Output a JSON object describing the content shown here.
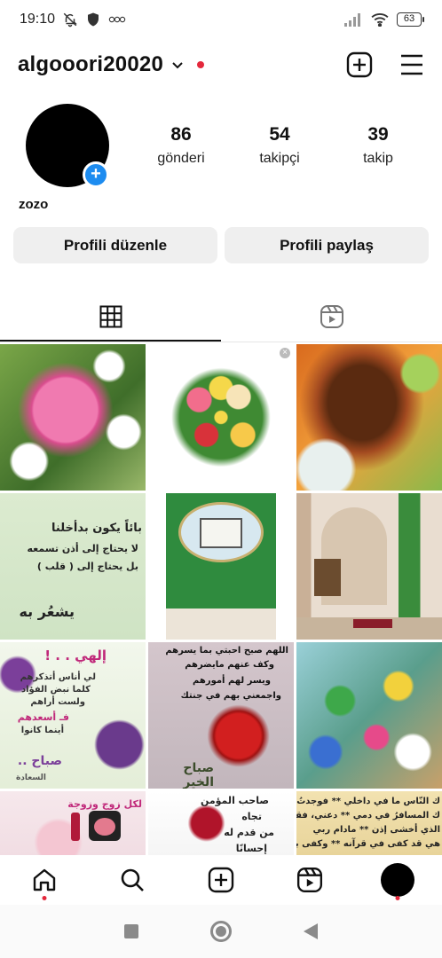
{
  "status_bar": {
    "time": "19:10",
    "battery": "63"
  },
  "header": {
    "username": "algooori20020"
  },
  "profile": {
    "display_name": "zozo",
    "stats": [
      {
        "value": "86",
        "label": "gönderi"
      },
      {
        "value": "54",
        "label": "takipçi"
      },
      {
        "value": "39",
        "label": "takip"
      }
    ],
    "edit_button": "Profili düzenle",
    "share_button": "Profili paylaş"
  },
  "grid": {
    "texts": {
      "c4_l1": "بائاً يكون بدأخلنا",
      "c4_l2": "لا يحتاج إلى أذن تسمعه",
      "c4_l3": "بل يحتاج إلى ( قلب )",
      "c4_l4": "يشعُر به",
      "c7_l1": "إلهي . . !",
      "c7_l2": "لي أناس أتذكرهم",
      "c7_l3": "كلما نبض الفؤاد",
      "c7_l4": "ولست أراهم",
      "c7_l5": "فـ أسعدهم",
      "c7_l6": "أينما كانوا",
      "c7_l7": "صباح ..",
      "c7_l8": "السعادة",
      "c8_l1": "اللهم صبح احبتي بما يسرهم",
      "c8_l2": "وكف عنهم مايضرهم",
      "c8_l3": "ويسر لهم أمورهم",
      "c8_l4": "واجمعني بهم في جنتك",
      "c8_l5": "صباح الخير",
      "c10_l1": "لكل زوج وزوجة",
      "c11_l1": "صاحب المؤمن",
      "c11_l2": "تجاه",
      "c11_l3": "من قدم له",
      "c11_l4": "إحسانًا",
      "c12_l1": "ك النّاس ما في داخلي ** فوجدتُ ربي",
      "c12_l2": "ك المسافرُ في دمي ** دعني، فقلبي",
      "c12_l3": "الذي أخشى إذن ** مادام ربي",
      "c12_l4": "هي قد كفى في قرآنه ** وكفى بربك"
    }
  },
  "colors": {
    "accent": "#1d8cf0",
    "notification": "#e4283c",
    "button_bg": "#efefef"
  }
}
